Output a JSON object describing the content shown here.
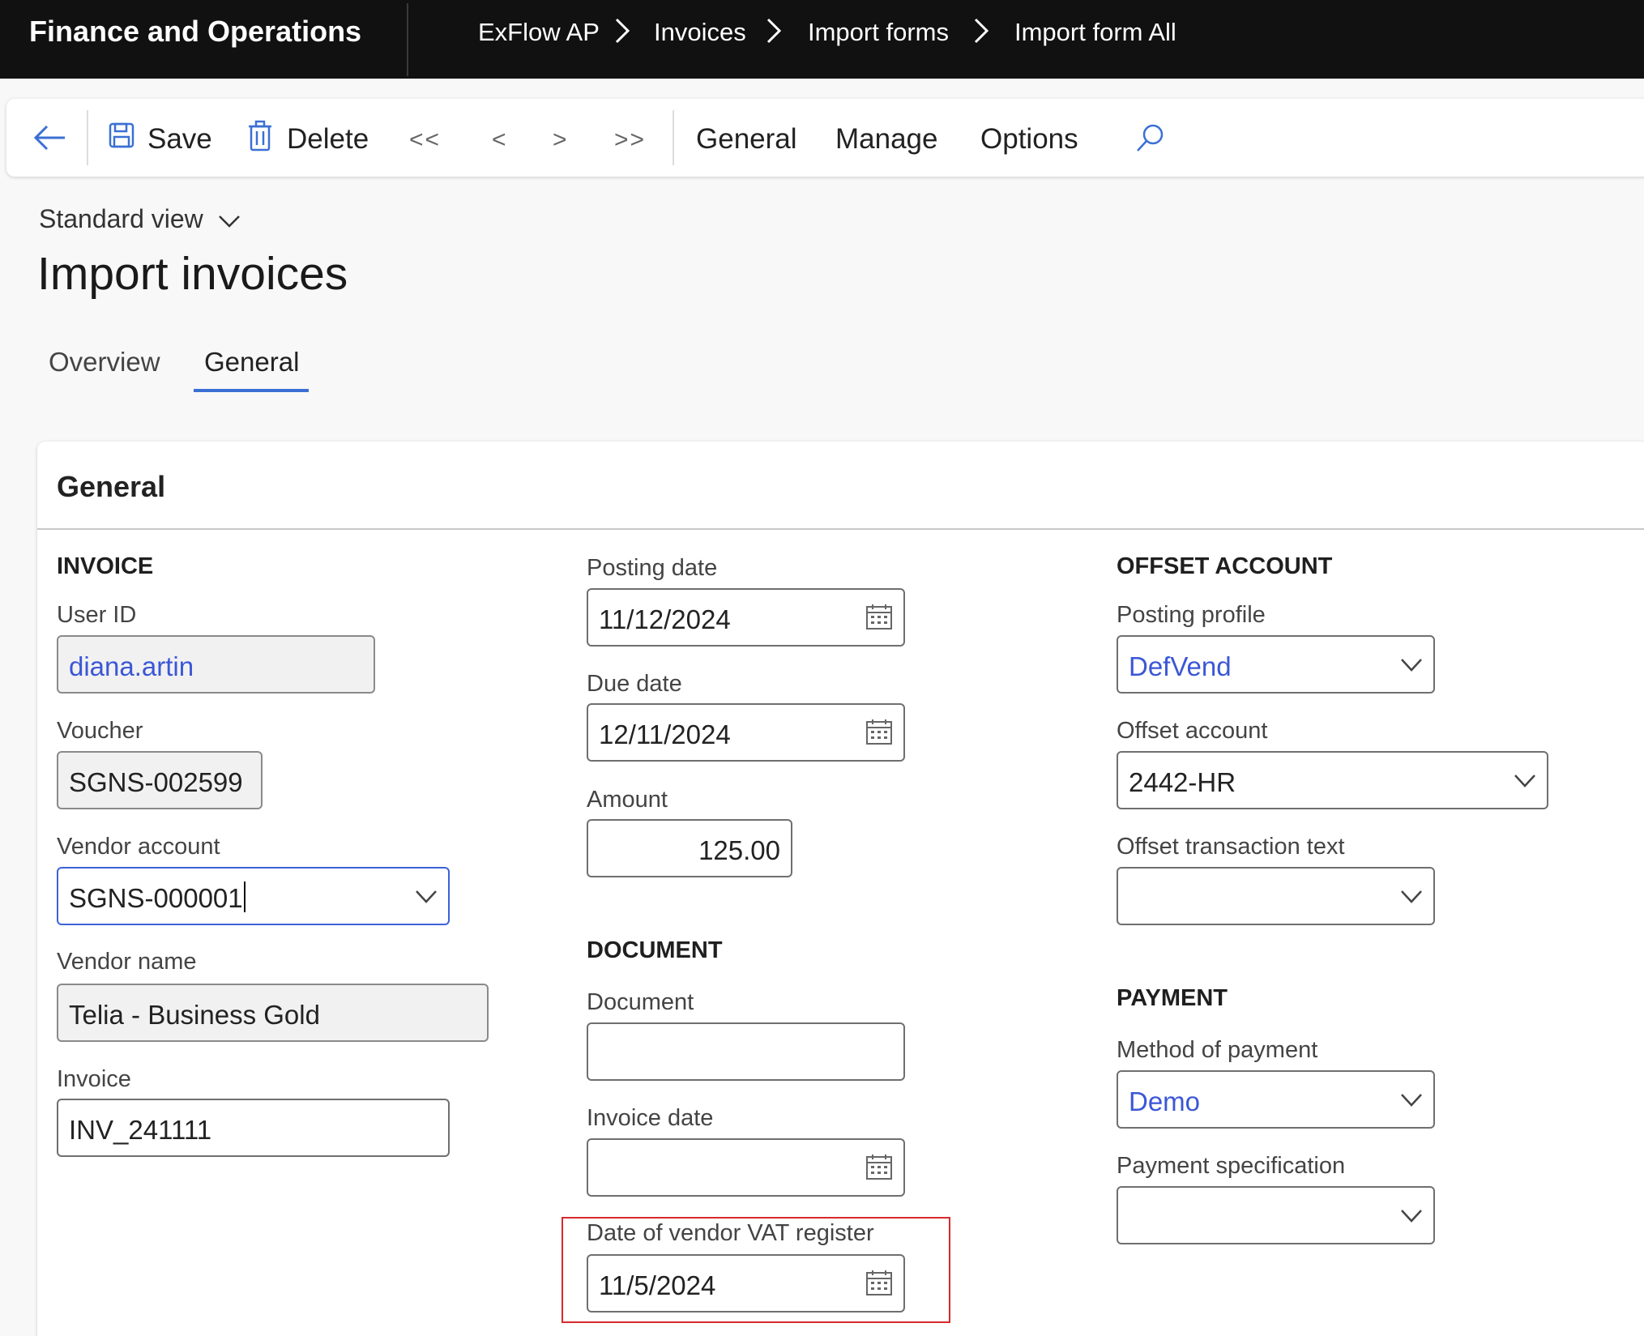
{
  "app": {
    "title": "Finance and Operations"
  },
  "breadcrumb": [
    "ExFlow AP",
    "Invoices",
    "Import forms",
    "Import form All"
  ],
  "toolbar": {
    "save_label": "Save",
    "delete_label": "Delete",
    "first_label": "<<",
    "prev_label": "<",
    "next_label": ">",
    "last_label": ">>",
    "menu": [
      "General",
      "Manage",
      "Options"
    ]
  },
  "view": {
    "label": "Standard view"
  },
  "page": {
    "title": "Import invoices"
  },
  "tabs": [
    {
      "label": "Overview",
      "active": false
    },
    {
      "label": "General",
      "active": true
    }
  ],
  "section": {
    "title": "General"
  },
  "invoice": {
    "heading": "INVOICE",
    "user_id": {
      "label": "User ID",
      "value": "diana.artin"
    },
    "voucher": {
      "label": "Voucher",
      "value": "SGNS-002599"
    },
    "vendor_account": {
      "label": "Vendor account",
      "value": "SGNS-000001"
    },
    "vendor_name": {
      "label": "Vendor name",
      "value": "Telia - Business Gold"
    },
    "invoice": {
      "label": "Invoice",
      "value": "INV_241111"
    }
  },
  "dates": {
    "posting_date": {
      "label": "Posting date",
      "value": "11/12/2024"
    },
    "due_date": {
      "label": "Due date",
      "value": "12/11/2024"
    },
    "amount": {
      "label": "Amount",
      "value": "125.00"
    }
  },
  "document": {
    "heading": "DOCUMENT",
    "document": {
      "label": "Document",
      "value": ""
    },
    "invoice_date": {
      "label": "Invoice date",
      "value": ""
    },
    "vat_register_date": {
      "label": "Date of vendor VAT register",
      "value": "11/5/2024"
    }
  },
  "offset": {
    "heading": "OFFSET ACCOUNT",
    "posting_profile": {
      "label": "Posting profile",
      "value": "DefVend"
    },
    "offset_account": {
      "label": "Offset account",
      "value": "2442-HR"
    },
    "offset_text": {
      "label": "Offset transaction text",
      "value": ""
    }
  },
  "payment": {
    "heading": "PAYMENT",
    "method": {
      "label": "Method of payment",
      "value": "Demo"
    },
    "specification": {
      "label": "Payment specification",
      "value": ""
    }
  },
  "colors": {
    "topbar": "#111111",
    "accent": "#3b6fd4",
    "link": "#3b57d6",
    "highlight": "#d62b2b"
  },
  "icons": [
    "back-arrow-icon",
    "save-icon",
    "delete-icon",
    "search-icon",
    "calendar-icon",
    "chevron-down-icon",
    "chevron-right-icon"
  ]
}
